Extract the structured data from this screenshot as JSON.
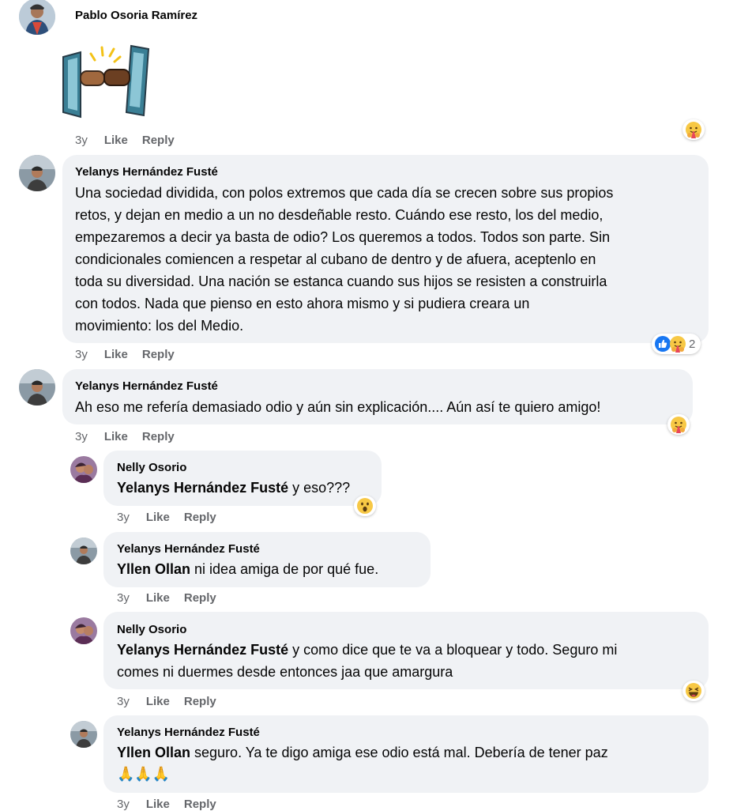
{
  "colors": {
    "bubble_bg": "#f0f2f5",
    "meta_text": "#65676b",
    "text": "#050505",
    "like_blue": "#1877f2",
    "emoji_yellow": "#f7c845"
  },
  "comments": [
    {
      "author": "Pablo Osoria Ramírez",
      "sticker": "fist-bump-phones-sticker",
      "age": "3y",
      "like": "Like",
      "reply": "Reply",
      "reaction": {
        "icons": [
          "care-emoji"
        ],
        "count": ""
      }
    },
    {
      "author": "Yelanys Hernández Fusté",
      "lines": [
        "Una sociedad dividida, con polos extremos que cada día se crecen sobre sus propios",
        "retos, y dejan en medio a un no desdeñable resto. Cuándo ese resto, los del medio,",
        "empezaremos a decir ya basta de odio? Los queremos a todos. Todos son parte. Sin",
        "condicionales comiencen a respetar al cubano de dentro y de afuera, aceptenlo en",
        "toda su diversidad. Una nación se estanca cuando sus hijos se resisten a construirla",
        "con todos. Nada que pienso en esto ahora mismo y si pudiera creara un",
        "movimiento: los del Medio."
      ],
      "age": "3y",
      "like": "Like",
      "reply": "Reply",
      "reaction": {
        "icons": [
          "like-emoji",
          "care-emoji"
        ],
        "count": "2"
      }
    },
    {
      "author": "Yelanys Hernández Fusté",
      "lines": [
        "Ah eso me refería demasiado odio y aún sin explicación.... Aún así te quiero amigo!"
      ],
      "age": "3y",
      "like": "Like",
      "reply": "Reply",
      "reaction": {
        "icons": [
          "care-emoji"
        ],
        "count": ""
      }
    },
    {
      "author": "Nelly Osorio",
      "mention": "Yelanys Hernández Fusté",
      "lines": [
        " y eso???"
      ],
      "age": "3y",
      "like": "Like",
      "reply": "Reply",
      "reaction": {
        "icons": [
          "wow-emoji"
        ],
        "count": ""
      }
    },
    {
      "author": "Yelanys Hernández Fusté",
      "mention": "Yllen Ollan",
      "lines": [
        " ni idea amiga de por qué fue."
      ],
      "age": "3y",
      "like": "Like",
      "reply": "Reply"
    },
    {
      "author": "Nelly Osorio",
      "mention": "Yelanys Hernández Fusté",
      "lines": [
        " y como dice que te va a bloquear y todo. Seguro mi",
        "comes ni duermes desde entonces jaa que amargura"
      ],
      "age": "3y",
      "like": "Like",
      "reply": "Reply",
      "reaction": {
        "icons": [
          "haha-emoji"
        ],
        "count": ""
      }
    },
    {
      "author": "Yelanys Hernández Fusté",
      "mention": "Yllen Ollan",
      "lines": [
        " seguro. Ya te digo amiga ese odio está mal. Debería de tener paz",
        "🙏🙏🙏"
      ],
      "age": "3y",
      "like": "Like",
      "reply": "Reply"
    }
  ]
}
